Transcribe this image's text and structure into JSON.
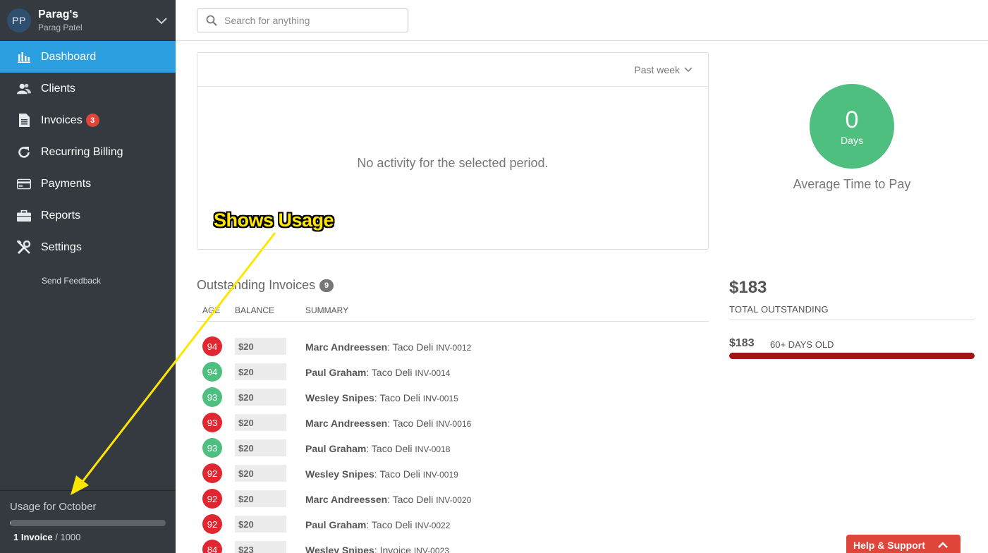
{
  "account": {
    "initials": "PP",
    "name": "Parag's",
    "user": "Parag Patel"
  },
  "sidebar": {
    "items": [
      {
        "label": "Dashboard",
        "icon": "bar-chart-icon",
        "active": true
      },
      {
        "label": "Clients",
        "icon": "users-icon"
      },
      {
        "label": "Invoices",
        "icon": "document-icon",
        "badge": "3"
      },
      {
        "label": "Recurring Billing",
        "icon": "refresh-icon"
      },
      {
        "label": "Payments",
        "icon": "credit-card-icon"
      },
      {
        "label": "Reports",
        "icon": "briefcase-icon"
      },
      {
        "label": "Settings",
        "icon": "tools-icon"
      }
    ],
    "feedback": "Send Feedback"
  },
  "usage": {
    "title": "Usage for October",
    "used": "1 Invoice",
    "limit": " / 1000",
    "fraction": 0.001
  },
  "search": {
    "placeholder": "Search for anything"
  },
  "activity": {
    "period": "Past week",
    "empty_message": "No activity for the selected period."
  },
  "annotation": {
    "text": "Shows Usage",
    "color": "#ffe600"
  },
  "time_to_pay": {
    "value": "0",
    "unit": "Days",
    "label": "Average Time to Pay"
  },
  "outstanding": {
    "title": "Outstanding Invoices",
    "count": "9",
    "columns": {
      "age": "AGE",
      "balance": "BALANCE",
      "summary": "SUMMARY"
    },
    "rows": [
      {
        "age": "94",
        "status": "red",
        "balance": "$20",
        "client": "Marc Andreessen",
        "desc": ": Taco Deli ",
        "invoice": "INV-0012"
      },
      {
        "age": "94",
        "status": "green",
        "balance": "$20",
        "client": "Paul Graham",
        "desc": ": Taco Deli ",
        "invoice": "INV-0014"
      },
      {
        "age": "93",
        "status": "green",
        "balance": "$20",
        "client": "Wesley Snipes",
        "desc": ": Taco Deli ",
        "invoice": "INV-0015"
      },
      {
        "age": "93",
        "status": "red",
        "balance": "$20",
        "client": "Marc Andreessen",
        "desc": ": Taco Deli ",
        "invoice": "INV-0016"
      },
      {
        "age": "93",
        "status": "green",
        "balance": "$20",
        "client": "Paul Graham",
        "desc": ": Taco Deli ",
        "invoice": "INV-0018"
      },
      {
        "age": "92",
        "status": "red",
        "balance": "$20",
        "client": "Wesley Snipes",
        "desc": ": Taco Deli ",
        "invoice": "INV-0019"
      },
      {
        "age": "92",
        "status": "red",
        "balance": "$20",
        "client": "Marc Andreessen",
        "desc": ": Taco Deli ",
        "invoice": "INV-0020"
      },
      {
        "age": "92",
        "status": "red",
        "balance": "$20",
        "client": "Paul Graham",
        "desc": ": Taco Deli ",
        "invoice": "INV-0022"
      },
      {
        "age": "84",
        "status": "red",
        "balance": "$23",
        "client": "Wesley Snipes",
        "desc": ": Invoice ",
        "invoice": "INV-0023"
      }
    ]
  },
  "totals": {
    "amount": "$183",
    "label": "TOTAL OUTSTANDING",
    "aging_amount": "$183",
    "aging_label": "60+ DAYS OLD"
  },
  "help": {
    "label": "Help & Support"
  },
  "colors": {
    "sidebar": "#343a40",
    "accent": "#2b9fe0",
    "overdue": "#e0262f",
    "ok": "#4fbf7f",
    "aging_bar": "#a01616",
    "help": "#e0453a"
  }
}
